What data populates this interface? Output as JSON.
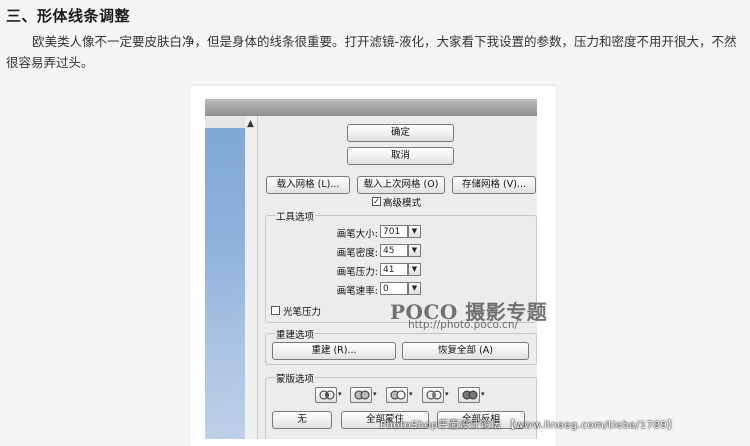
{
  "article": {
    "heading": "三、形体线条调整",
    "paragraph": "欧美类人像不一定要皮肤白净，但是身体的线条很重要。打开滤镜-液化，大家看下我设置的参数，压力和密度不用开很大，不然很容易弄过头。"
  },
  "dialog": {
    "ok_label": "确定",
    "cancel_label": "取消",
    "load_mesh_label": "载入网格 (L)...",
    "load_last_mesh_label": "载入上次网格 (O)",
    "save_mesh_label": "存储网格 (V)...",
    "advanced_mode_label": "高级模式",
    "advanced_mode_checked": true,
    "tool_options": {
      "title": "工具选项",
      "brush_size_label": "画笔大小:",
      "brush_size_value": "701",
      "brush_density_label": "画笔密度:",
      "brush_density_value": "45",
      "brush_pressure_label": "画笔压力:",
      "brush_pressure_value": "41",
      "brush_rate_label": "画笔速率:",
      "brush_rate_value": "0",
      "stylus_pressure_label": "光笔压力",
      "stylus_pressure_checked": false
    },
    "reconstruct_options": {
      "title": "重建选项",
      "reconstruct_label": "重建 (R)...",
      "restore_all_label": "恢复全部 (A)"
    },
    "mask_options": {
      "title": "蒙版选项",
      "none_label": "无",
      "mask_all_label": "全部蒙住",
      "invert_all_label": "全部反相"
    }
  },
  "watermarks": {
    "poco_brand": "POCO",
    "poco_cn": "摄影专题",
    "poco_url": "http://photo.poco.cn/",
    "forum_text": "PhotoShop平面设计论坛  【www.lineeg.com/tieba/1789】"
  }
}
